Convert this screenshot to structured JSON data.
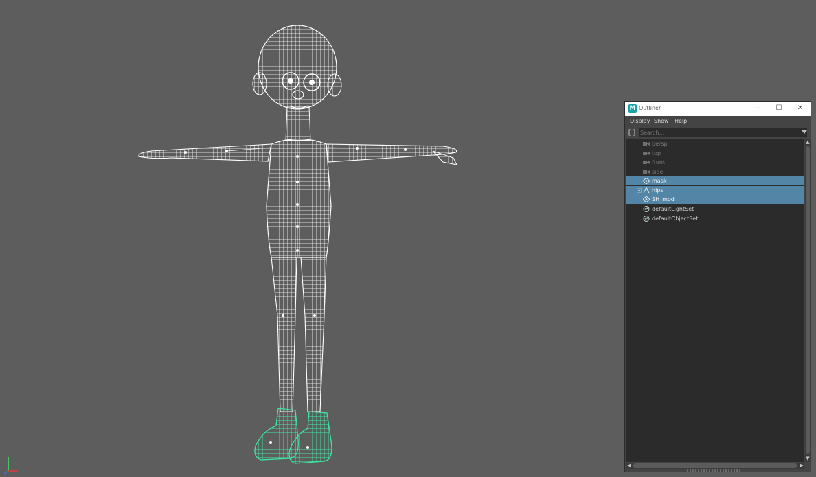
{
  "outliner": {
    "title": "Outliner",
    "menu": [
      "Display",
      "Show",
      "Help"
    ],
    "search_placeholder": "Search...",
    "items": [
      {
        "label": "persp",
        "kind": "camera",
        "selected": false
      },
      {
        "label": "top",
        "kind": "camera",
        "selected": false
      },
      {
        "label": "front",
        "kind": "camera",
        "selected": false
      },
      {
        "label": "side",
        "kind": "camera",
        "selected": false
      },
      {
        "label": "mask",
        "kind": "transform",
        "selected": true
      },
      {
        "label": "hips",
        "kind": "joint",
        "selected": true,
        "expandable": true
      },
      {
        "label": "SH_mod",
        "kind": "transform",
        "selected": true
      },
      {
        "label": "defaultLightSet",
        "kind": "set",
        "selected": false
      },
      {
        "label": "defaultObjectSet",
        "kind": "set",
        "selected": false
      }
    ]
  },
  "colors": {
    "viewport_bg": "#5d5d5d",
    "wireframe": "#ffffff",
    "selected_wire": "#3ee6a3",
    "selection_row": "#5285a6",
    "tree_bg": "#2b2b2b",
    "panel_bg": "#444444"
  }
}
